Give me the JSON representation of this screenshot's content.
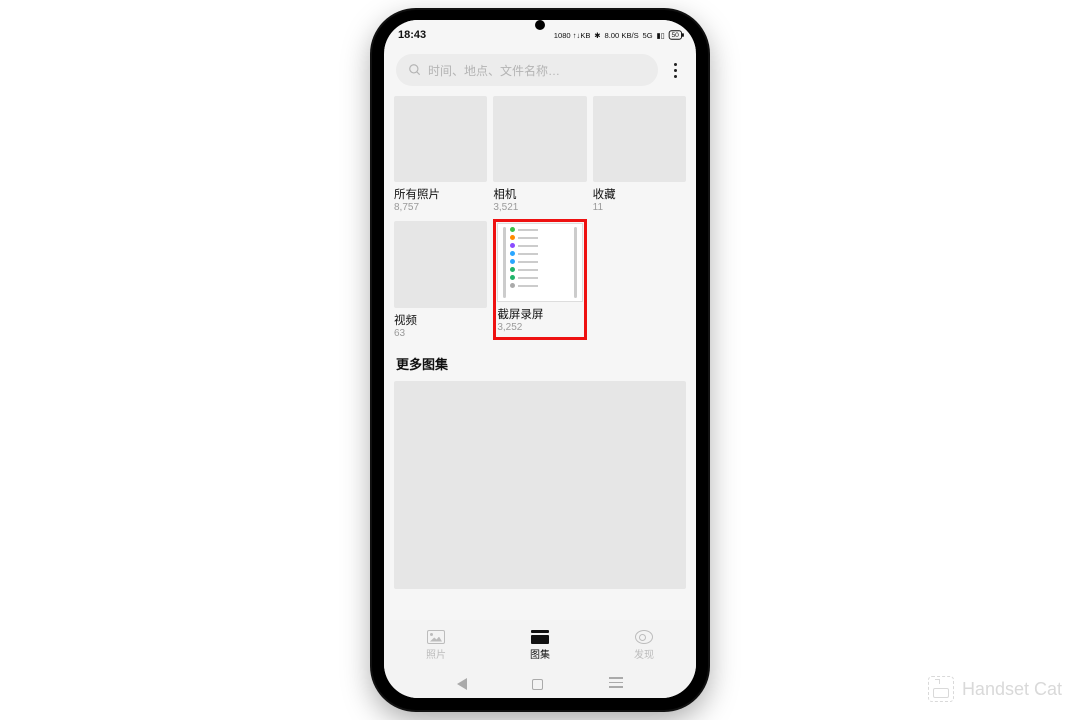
{
  "status": {
    "time": "18:43",
    "net1": "1080 ↑↓KB",
    "bt": "✱",
    "speed": "8.00 KB/S",
    "sig": "5G",
    "battery": "50"
  },
  "search": {
    "placeholder": "时间、地点、文件名称…"
  },
  "albums_top": [
    {
      "title": "所有照片",
      "count": "8,757"
    },
    {
      "title": "相机",
      "count": "3,521"
    },
    {
      "title": "收藏",
      "count": "11"
    }
  ],
  "albums_mid": [
    {
      "title": "视频",
      "count": "63"
    },
    {
      "title": "截屏录屏",
      "count": "3,252"
    }
  ],
  "sshot_colors": [
    "#3bbf4a",
    "#ff8a00",
    "#8a4bff",
    "#2aa6ff",
    "#2aa6ff",
    "#21b36a",
    "#21b36a",
    "#aaaaaa"
  ],
  "section_more": "更多图集",
  "tabs": [
    {
      "label": "照片"
    },
    {
      "label": "图集"
    },
    {
      "label": "发现"
    }
  ],
  "watermark": "Handset Cat"
}
